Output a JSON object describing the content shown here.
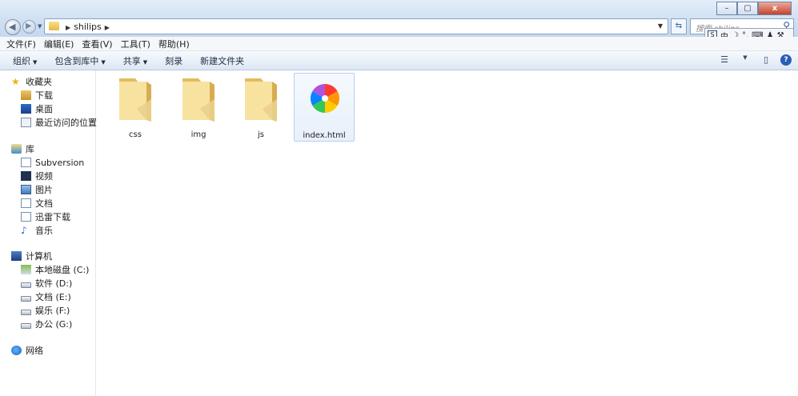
{
  "window": {
    "address_crumbs": [
      "shilips"
    ],
    "search_placeholder": "搜索 shilips",
    "controls": {
      "minimize": "–",
      "maximize": "▢",
      "close": "x"
    },
    "ime_label": "中"
  },
  "menu": [
    "文件(F)",
    "编辑(E)",
    "查看(V)",
    "工具(T)",
    "帮助(H)"
  ],
  "commands": [
    {
      "label": "组织",
      "dropdown": true
    },
    {
      "label": "包含到库中",
      "dropdown": true
    },
    {
      "label": "共享",
      "dropdown": true
    },
    {
      "label": "刻录",
      "dropdown": false
    },
    {
      "label": "新建文件夹",
      "dropdown": false
    }
  ],
  "nav": {
    "favorites": {
      "label": "收藏夹",
      "items": [
        "下载",
        "桌面",
        "最近访问的位置"
      ]
    },
    "libraries": {
      "label": "库",
      "items": [
        "Subversion",
        "视频",
        "图片",
        "文档",
        "迅雷下载",
        "音乐"
      ]
    },
    "computer": {
      "label": "计算机",
      "items": [
        "本地磁盘 (C:)",
        "软件 (D:)",
        "文档 (E:)",
        "娱乐 (F:)",
        "办公 (G:)"
      ]
    },
    "network": {
      "label": "网络"
    }
  },
  "files": [
    {
      "name": "css",
      "type": "folder",
      "selected": false
    },
    {
      "name": "img",
      "type": "folder",
      "selected": false
    },
    {
      "name": "js",
      "type": "folder",
      "selected": false
    },
    {
      "name": "index.html",
      "type": "html",
      "selected": true
    }
  ],
  "colors": {
    "folder_light": "#f8e6a8",
    "folder_dark": "#e6c06a",
    "selection_border": "#bcd0ea",
    "accent": "#2a5fb7"
  }
}
